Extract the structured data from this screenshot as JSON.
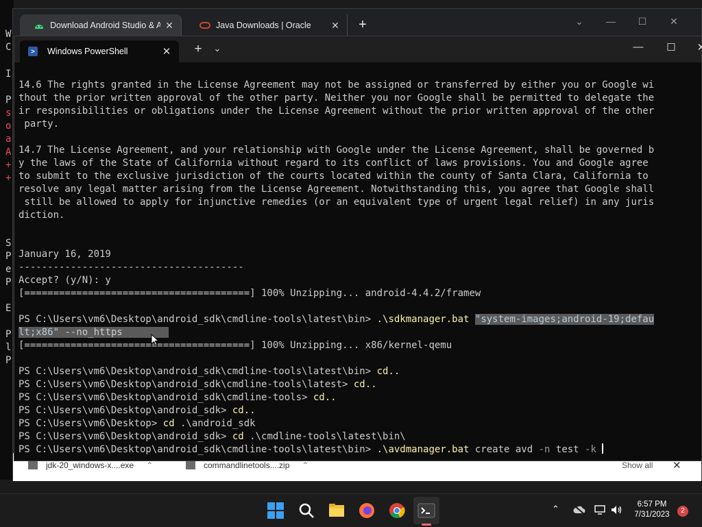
{
  "background_window": {
    "edge_letters": [
      "W",
      "C",
      "I",
      "P",
      "s",
      "o",
      "a",
      "A",
      "+",
      "+",
      "S",
      "P",
      "e",
      "P",
      "E",
      "P",
      "l",
      "P"
    ]
  },
  "browser": {
    "tabs": [
      {
        "label": "Download Android Studio & App",
        "icon": "android-icon",
        "icon_color": "#3ddc84"
      },
      {
        "label": "Java Downloads | Oracle",
        "icon": "oracle-icon",
        "icon_color": "#c74634"
      }
    ],
    "new_tab": "+",
    "downloads": [
      {
        "name": "jdk-20_windows-x....exe"
      },
      {
        "name": "commandlinetools....zip"
      }
    ],
    "show_all": "Show all"
  },
  "terminal": {
    "tab_title": "Windows PowerShell",
    "new_tab": "+",
    "lines": [
      [
        {
          "t": "14.6 The rights granted in the License Agreement may not be assigned or transferred by either you or Google wi"
        }
      ],
      [
        {
          "t": "thout the prior written approval of the other party. Neither you nor Google shall be permitted to delegate the"
        }
      ],
      [
        {
          "t": "ir responsibilities or obligations under the License Agreement without the prior written approval of the other"
        }
      ],
      [
        {
          "t": " party."
        }
      ],
      [
        {
          "t": ""
        }
      ],
      [
        {
          "t": "14.7 The License Agreement, and your relationship with Google under the License Agreement, shall be governed b"
        }
      ],
      [
        {
          "t": "y the laws of the State of California without regard to its conflict of laws provisions. You and Google agree"
        }
      ],
      [
        {
          "t": "to submit to the exclusive jurisdiction of the courts located within the county of Santa Clara, California to"
        }
      ],
      [
        {
          "t": "resolve any legal matter arising from the License Agreement. Notwithstanding this, you agree that Google shall"
        }
      ],
      [
        {
          "t": " still be allowed to apply for injunctive remedies (or an equivalent type of urgent legal relief) in any juris"
        }
      ],
      [
        {
          "t": "diction."
        }
      ],
      [
        {
          "t": ""
        }
      ],
      [
        {
          "t": ""
        }
      ],
      [
        {
          "t": "January 16, 2019"
        }
      ],
      [
        {
          "t": "---------------------------------------"
        }
      ],
      [
        {
          "t": "Accept? (y/N): y"
        }
      ],
      [
        {
          "t": "[=======================================] 100% Unzipping... android-4.4.2/framew"
        }
      ],
      [
        {
          "t": ""
        }
      ],
      [
        {
          "t": "PS C:\\Users\\vm6\\Desktop\\android_sdk\\cmdline-tools\\latest\\bin> "
        },
        {
          "t": ".\\sdkmanager.bat",
          "c": "cmd"
        },
        {
          "t": " "
        },
        {
          "t": "\"system-images;android-19;defau",
          "c": "sel-arg"
        }
      ],
      [
        {
          "t": "lt;x86\"",
          "c": "sel-arg"
        },
        {
          "t": " --no_https",
          "c": "sel"
        },
        {
          "t": "        ",
          "c": "sel"
        }
      ],
      [
        {
          "t": "[=======================================] 100% Unzipping... x86/kernel-qemu"
        }
      ],
      [
        {
          "t": ""
        }
      ],
      [
        {
          "t": "PS C:\\Users\\vm6\\Desktop\\android_sdk\\cmdline-tools\\latest\\bin> "
        },
        {
          "t": "cd..",
          "c": "cmd"
        }
      ],
      [
        {
          "t": "PS C:\\Users\\vm6\\Desktop\\android_sdk\\cmdline-tools\\latest> "
        },
        {
          "t": "cd..",
          "c": "cmd"
        }
      ],
      [
        {
          "t": "PS C:\\Users\\vm6\\Desktop\\android_sdk\\cmdline-tools> "
        },
        {
          "t": "cd..",
          "c": "cmd"
        }
      ],
      [
        {
          "t": "PS C:\\Users\\vm6\\Desktop\\android_sdk> "
        },
        {
          "t": "cd..",
          "c": "cmd"
        }
      ],
      [
        {
          "t": "PS C:\\Users\\vm6\\Desktop> "
        },
        {
          "t": "cd",
          "c": "cmd"
        },
        {
          "t": " .\\android_sdk"
        }
      ],
      [
        {
          "t": "PS C:\\Users\\vm6\\Desktop\\android_sdk> "
        },
        {
          "t": "cd",
          "c": "cmd"
        },
        {
          "t": " .\\cmdline-tools\\latest\\bin\\"
        }
      ],
      [
        {
          "t": "PS C:\\Users\\vm6\\Desktop\\android_sdk\\cmdline-tools\\latest\\bin> "
        },
        {
          "t": ".\\avdmanager.bat",
          "c": "cmd"
        },
        {
          "t": " create avd "
        },
        {
          "t": "-n",
          "c": "arg"
        },
        {
          "t": " test "
        },
        {
          "t": "-k",
          "c": "arg"
        },
        {
          "t": " "
        },
        {
          "cursor": true
        }
      ]
    ]
  },
  "taskbar": {
    "apps": [
      "windows-start-icon",
      "search-icon",
      "file-explorer-icon",
      "firefox-icon",
      "chrome-icon",
      "terminal-icon"
    ],
    "tray_time": "6:57 PM",
    "tray_date": "7/31/2023",
    "notifications": "2"
  },
  "colors": {
    "terminal_bg": "#0c0c0c",
    "command_yellow": "#f9f1a5",
    "taskbar_bg": "#1c1c1c",
    "notification_badge": "#d64545"
  }
}
